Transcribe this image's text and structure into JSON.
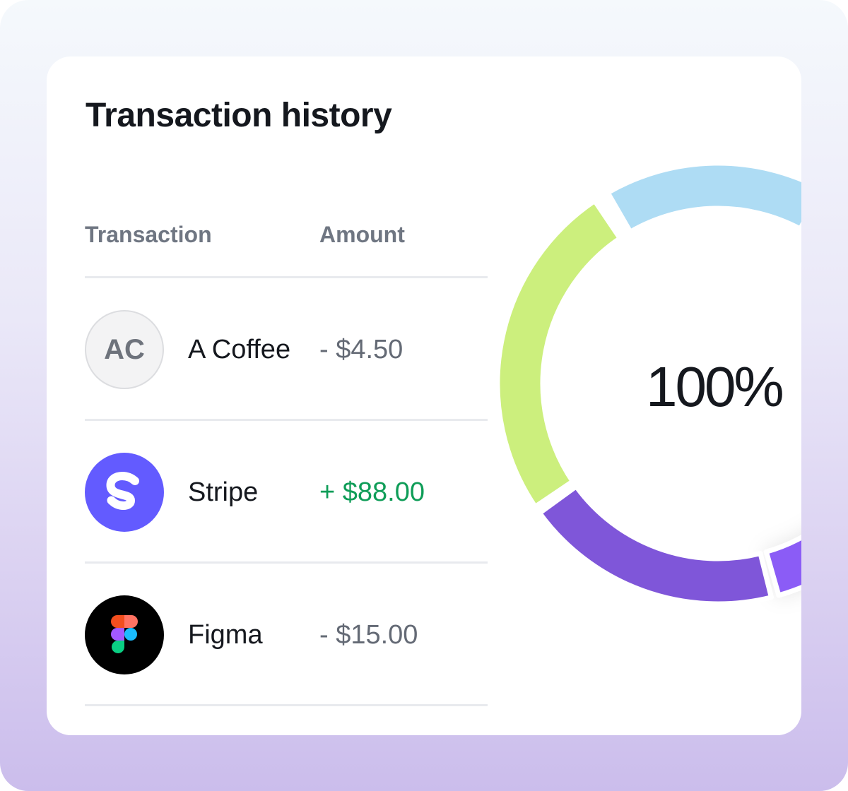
{
  "card": {
    "title": "Transaction history"
  },
  "table": {
    "columns": [
      "Transaction",
      "Amount"
    ],
    "rows": [
      {
        "avatar_text": "AC",
        "avatar_icon": "initials-avatar",
        "name": "A Coffee",
        "amount": "- $4.50",
        "direction": "debit"
      },
      {
        "avatar_text": "",
        "avatar_icon": "stripe-logo-icon",
        "name": "Stripe",
        "amount": "+ $88.00",
        "direction": "credit"
      },
      {
        "avatar_text": "",
        "avatar_icon": "figma-logo-icon",
        "name": "Figma",
        "amount": "- $15.00",
        "direction": "debit"
      }
    ]
  },
  "chart_data": {
    "type": "pie",
    "style": "donut",
    "center_label": "100%",
    "segments": [
      {
        "color": "#aedcf4"
      },
      {
        "color": "#8b5cf6"
      },
      {
        "color": "#7f56d9"
      },
      {
        "color": "#ccef7d"
      }
    ]
  },
  "colors": {
    "credit": "#0f9d58",
    "debit": "#646a75",
    "stripe": "#635bff",
    "title": "#15181e"
  }
}
